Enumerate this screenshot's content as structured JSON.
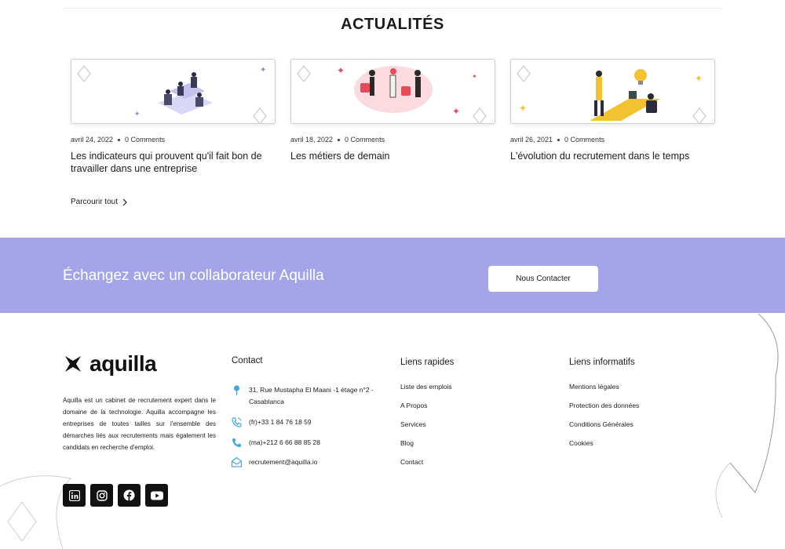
{
  "news": {
    "title": "ACTUALITÉS",
    "posts": [
      {
        "date": "avril 24, 2022",
        "comments": "0 Comments",
        "title": "Les indicateurs qui prouvent qu'il fait bon de travailler dans une entreprise"
      },
      {
        "date": "avril 18, 2022",
        "comments": "0 Comments",
        "title": "Les métiers de demain"
      },
      {
        "date": "avril 26, 2021",
        "comments": "0 Comments",
        "title": "L'évolution du recrutement dans le temps"
      }
    ],
    "browse_label": "Parcourir tout"
  },
  "cta": {
    "text": "Échangez avec un collaborateur Aquilla",
    "button_label": "Nous Contacter",
    "band_color": "#a5a4e9"
  },
  "footer": {
    "logo_text": "aquilla",
    "about": "Aquilla est un cabinet de recrutement expert dans le domaine de la technologie. Aquilla accompagne les entreprises de toutes tailles sur l'ensemble des démarches liés aux recrutements mais également les candidats en recherche d'emploi.",
    "contact": {
      "heading": "Contact",
      "address": "31, Rue Mustapha El Maani -1 étage n°2 - Casablanca",
      "phone_fr": "(fr)+33 1 84 76 18 59",
      "phone_ma": "(ma)+212 6 66 88 85 28",
      "email": "recrutement@aquilla.io",
      "icon_color": "#4aa8d8"
    },
    "quick_links": {
      "heading": "Liens rapides",
      "items": [
        "Liste des emplois",
        "A Propos",
        "Services",
        "Blog",
        "Contact"
      ]
    },
    "info_links": {
      "heading": "Liens informatifs",
      "items": [
        "Mentions légales",
        "Protection des données",
        "Conditions Générales",
        "Cookies"
      ]
    },
    "socials": [
      "linkedin-icon",
      "instagram-icon",
      "facebook-icon",
      "youtube-icon"
    ]
  }
}
